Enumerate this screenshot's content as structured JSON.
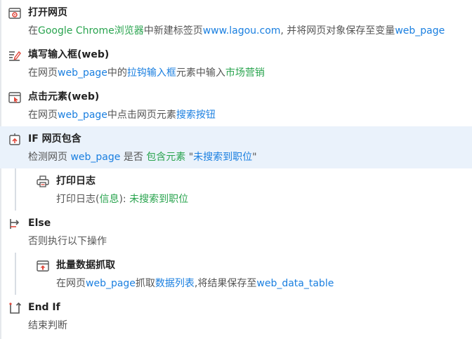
{
  "steps": [
    {
      "title": "打开网页",
      "icon": "browser-icon",
      "desc": {
        "p1": "在",
        "browser": "Google Chrome浏览器",
        "p2": "中新建标签页",
        "url": "www.lagou.com",
        "p3": ", 并将网页对象保存至变量",
        "var": "web_page"
      }
    },
    {
      "title": "填写输入框(web)",
      "icon": "edit-input-icon",
      "desc": {
        "p1": "在网页",
        "var": "web_page",
        "p2": "中的",
        "element": "拉钩输入框",
        "p3": "元素中输入",
        "text": "市场营销"
      }
    },
    {
      "title": "点击元素(web)",
      "icon": "click-icon",
      "desc": {
        "p1": "在网页",
        "var": "web_page",
        "p2": "中点击网页元素",
        "element": "搜索按钮"
      }
    },
    {
      "title": "IF 网页包含",
      "icon": "if-condition-icon",
      "desc": {
        "p1": "检测网页 ",
        "var": "web_page",
        "p2": " 是否 ",
        "cond": "包含元素",
        "p3": " \"",
        "element": "未搜索到职位",
        "p4": "\""
      }
    },
    {
      "title": "打印日志",
      "icon": "printer-icon",
      "desc": {
        "p1": "打印日志(",
        "level": "信息",
        "p2": "): ",
        "msg": "未搜索到职位"
      }
    },
    {
      "title": "Else",
      "icon": "else-branch-icon",
      "desc": {
        "p1": "否则执行以下操作"
      }
    },
    {
      "title": "批量数据抓取",
      "icon": "data-scrape-icon",
      "desc": {
        "p1": "在网页",
        "var": "web_page",
        "p2": "抓取",
        "element": "数据列表",
        "p3": ",将结果保存至",
        "result": "web_data_table"
      }
    },
    {
      "title": "End If",
      "icon": "end-if-icon",
      "desc": {
        "p1": "结束判断"
      }
    }
  ],
  "colors": {
    "variable": "#1a7fe0",
    "value": "#2aa44f",
    "highlight_row": "#eaf2fb"
  }
}
